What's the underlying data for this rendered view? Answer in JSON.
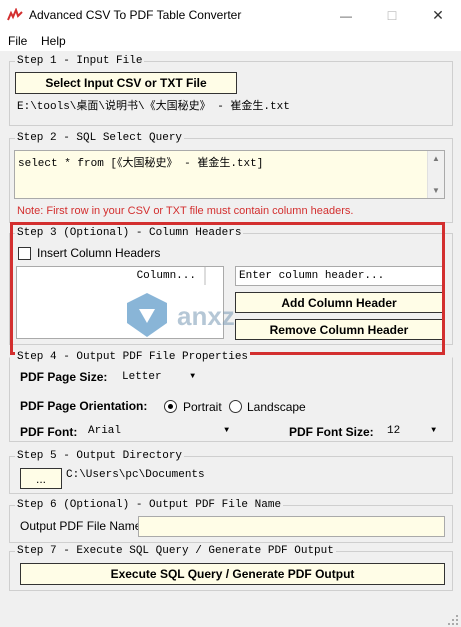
{
  "window": {
    "title": "Advanced CSV To PDF Table Converter",
    "minimize_glyph": "—",
    "maximize_glyph": "☐",
    "close_glyph": "✕"
  },
  "menu": {
    "file": "File",
    "help": "Help"
  },
  "step1": {
    "label": "Step 1 - Input File",
    "button": "Select Input CSV or TXT File",
    "path": "E:\\tools\\桌面\\说明书\\《大国秘史》 - 崔金生.txt"
  },
  "step2": {
    "label": "Step 2 - SQL Select Query",
    "query": "select * from [《大国秘史》 - 崔金生.txt]",
    "note": "Note: First row in your CSV or TXT file must contain column headers."
  },
  "step3": {
    "label": "Step 3 (Optional) - Column Headers",
    "checkbox_label": "Insert Column Headers",
    "list_header": "Column...",
    "input_placeholder": "Enter column header...",
    "add_button": "Add Column Header",
    "remove_button": "Remove Column Header"
  },
  "step4": {
    "label": "Step 4 - Output PDF File Properties",
    "page_size_label": "PDF Page Size:",
    "page_size_value": "Letter",
    "orientation_label": "PDF Page Orientation:",
    "portrait": "Portrait",
    "landscape": "Landscape",
    "orientation_selected": "Portrait",
    "font_label": "PDF Font:",
    "font_value": "Arial",
    "font_size_label": "PDF Font Size:",
    "font_size_value": "12"
  },
  "step5": {
    "label": "Step 5 - Output Directory",
    "browse_button": "...",
    "directory": "C:\\Users\\pc\\Documents"
  },
  "step6": {
    "label": "Step 6 (Optional) - Output PDF File Name",
    "field_label": "Output PDF File Name:",
    "value": ""
  },
  "step7": {
    "label": "Step 7 - Execute SQL Query / Generate PDF Output",
    "button": "Execute SQL Query / Generate PDF Output"
  },
  "watermark": {
    "text": "anxz.com"
  },
  "colors": {
    "field_bg": "#fffde7",
    "highlight": "#d32f2f",
    "note": "#d32f2f"
  }
}
